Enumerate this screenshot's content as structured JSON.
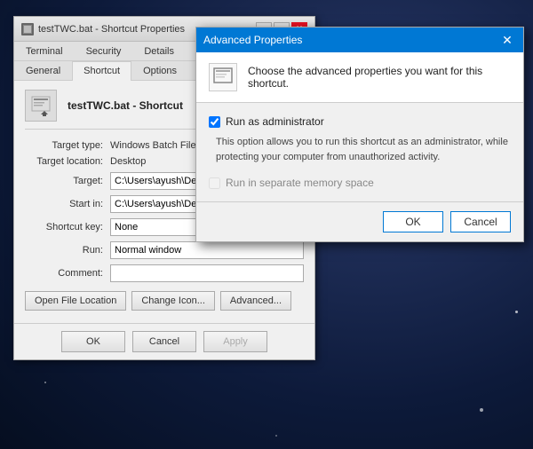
{
  "background": {
    "color": "#1a2a4a"
  },
  "shortcut_window": {
    "title": "testTWC.bat - Shortcut Properties",
    "tabs_row1": [
      "Terminal",
      "Security",
      "Details"
    ],
    "tabs_row2_labels": [
      "General",
      "Shortcut",
      "Options"
    ],
    "active_tab": "Shortcut",
    "shortcut_name": "testTWC.bat - Shortcut",
    "fields": {
      "target_type_label": "Target type:",
      "target_type_value": "Windows Batch File",
      "target_location_label": "Target location:",
      "target_location_value": "Desktop",
      "target_label": "Target:",
      "target_value": "C:\\Users\\ayush\\Desktop",
      "start_in_label": "Start in:",
      "start_in_value": "C:\\Users\\ayush\\Desktop",
      "shortcut_key_label": "Shortcut key:",
      "shortcut_key_value": "None",
      "run_label": "Run:",
      "run_value": "Normal window",
      "comment_label": "Comment:",
      "comment_value": ""
    },
    "buttons": {
      "open_file_location": "Open File Location",
      "change_icon": "Change Icon...",
      "advanced": "Advanced..."
    },
    "bottom_buttons": {
      "ok": "OK",
      "cancel": "Cancel",
      "apply": "Apply"
    }
  },
  "advanced_dialog": {
    "title": "Advanced Properties",
    "header_text": "Choose the advanced properties you want for this shortcut.",
    "run_as_admin_label": "Run as administrator",
    "run_as_admin_checked": true,
    "description": "This option allows you to run this shortcut as an administrator, while protecting your computer from unauthorized activity.",
    "run_separate_memory_label": "Run in separate memory space",
    "run_separate_memory_disabled": true,
    "ok_label": "OK",
    "cancel_label": "Cancel"
  }
}
